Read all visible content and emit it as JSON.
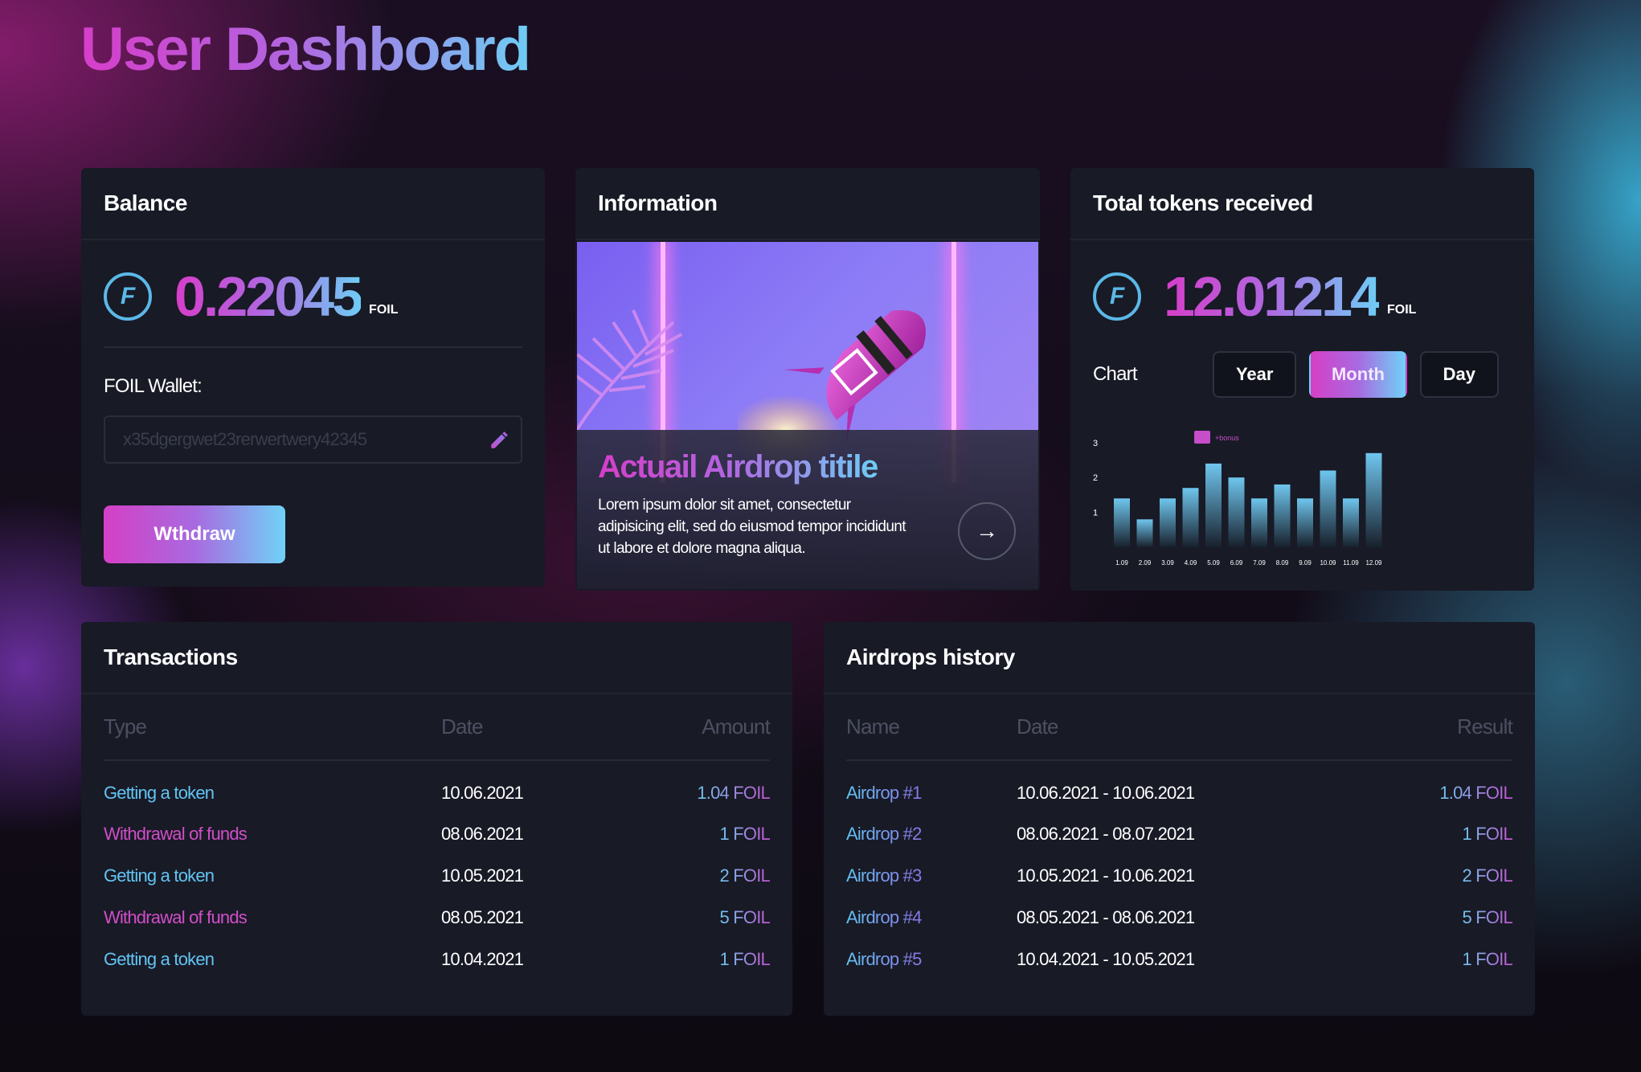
{
  "page": {
    "title": "User Dashboard"
  },
  "balance": {
    "title": "Balance",
    "amount": "0.22045",
    "unit": "FOIL",
    "wallet_label": "FOIL Wallet:",
    "wallet_placeholder": "x35dgergwet23rerwertwery42345",
    "withdraw_label": "Wthdraw"
  },
  "information": {
    "title": "Information",
    "airdrop_title": "Actuail Airdrop titile",
    "airdrop_text": "Lorem ipsum dolor sit amet, consectetur adipisicing elit, sed do eiusmod tempor incididunt ut labore et dolore magna aliqua.",
    "arrow_icon": "arrow-right-icon"
  },
  "tokens": {
    "title": "Total tokens received",
    "amount": "12.01214",
    "unit": "FOIL",
    "chart_label": "Chart",
    "periods": [
      "Year",
      "Month",
      "Day"
    ],
    "active_period": "Month"
  },
  "chart_data": {
    "type": "bar",
    "categories": [
      "1.09",
      "2.09",
      "3.09",
      "4.09",
      "5.09",
      "6.09",
      "7.09",
      "8.09",
      "9.09",
      "10.09",
      "11.09",
      "12.09"
    ],
    "series": [
      {
        "name": "",
        "values": [
          1.4,
          0.8,
          1.4,
          1.7,
          2.4,
          2.0,
          1.4,
          1.8,
          1.4,
          2.2,
          1.4,
          2.7
        ]
      }
    ],
    "legend": [
      "+bonus"
    ],
    "ylim": [
      0,
      3
    ],
    "yticks": [
      1,
      2,
      3
    ],
    "colors": {
      "bar_top": "#6fc6ee",
      "bar_bottom": "#18202c",
      "legend": "#c64ec9"
    }
  },
  "transactions": {
    "title": "Transactions",
    "columns": [
      "Type",
      "Date",
      "Amount"
    ],
    "rows": [
      {
        "type": "Getting a token",
        "date": "10.06.2021",
        "amount": "1.04 FOIL",
        "kind": "in"
      },
      {
        "type": "Withdrawal of funds",
        "date": "08.06.2021",
        "amount": "1 FOIL",
        "kind": "out"
      },
      {
        "type": "Getting a token",
        "date": "10.05.2021",
        "amount": "2 FOIL",
        "kind": "in"
      },
      {
        "type": "Withdrawal of funds",
        "date": "08.05.2021",
        "amount": "5 FOIL",
        "kind": "out"
      },
      {
        "type": "Getting a token",
        "date": "10.04.2021",
        "amount": "1 FOIL",
        "kind": "in"
      }
    ]
  },
  "airdrops": {
    "title": "Airdrops history",
    "columns": [
      "Name",
      "Date",
      "Result"
    ],
    "rows": [
      {
        "name": "Airdrop #1",
        "date": "10.06.2021 - 10.06.2021",
        "result": "1.04 FOIL"
      },
      {
        "name": "Airdrop #2",
        "date": "08.06.2021 - 08.07.2021",
        "result": "1 FOIL"
      },
      {
        "name": "Airdrop #3",
        "date": "10.05.2021 - 10.06.2021",
        "result": "2 FOIL"
      },
      {
        "name": "Airdrop #4",
        "date": "08.05.2021 - 08.06.2021",
        "result": "5 FOIL"
      },
      {
        "name": "Airdrop #5",
        "date": "10.04.2021 - 10.05.2021",
        "result": "1 FOIL"
      }
    ]
  }
}
